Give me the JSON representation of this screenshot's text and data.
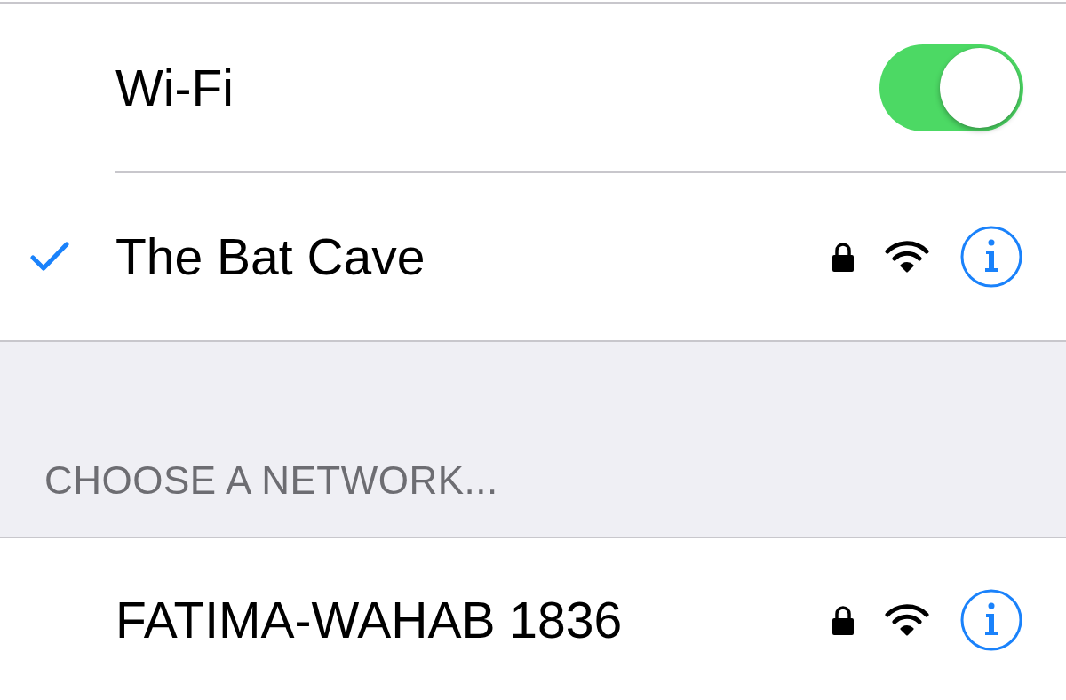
{
  "wifi": {
    "label": "Wi-Fi",
    "on": true
  },
  "current_network": {
    "name": "The Bat Cave",
    "connected": true,
    "secure": true
  },
  "section_header": "CHOOSE A NETWORK...",
  "networks": [
    {
      "name": "FATIMA-WAHAB 1836",
      "connected": false,
      "secure": true
    }
  ]
}
